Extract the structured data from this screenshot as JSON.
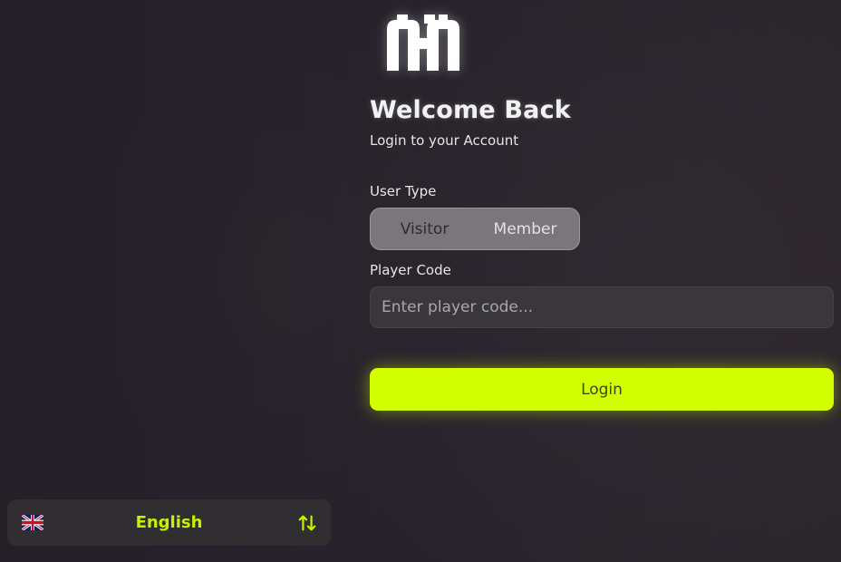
{
  "brand": {
    "logo_icon": "m-logo-icon"
  },
  "header": {
    "title": "Welcome Back",
    "subtitle": "Login to your Account"
  },
  "form": {
    "user_type": {
      "label": "User Type",
      "options": [
        "Visitor",
        "Member"
      ],
      "selected": "Visitor"
    },
    "player_code": {
      "label": "Player Code",
      "placeholder": "Enter player code...",
      "value": ""
    },
    "login_label": "Login"
  },
  "language": {
    "flag_icon": "uk-flag-icon",
    "label": "English",
    "swap_icon": "swap-vertical-icon"
  },
  "colors": {
    "accent": "#d4ff00",
    "accent_text": "#c8f000",
    "background": "#231f26",
    "segmented_bg": "#7a777b",
    "input_bg": "#3a373a",
    "lang_bar_bg": "#312e32"
  }
}
